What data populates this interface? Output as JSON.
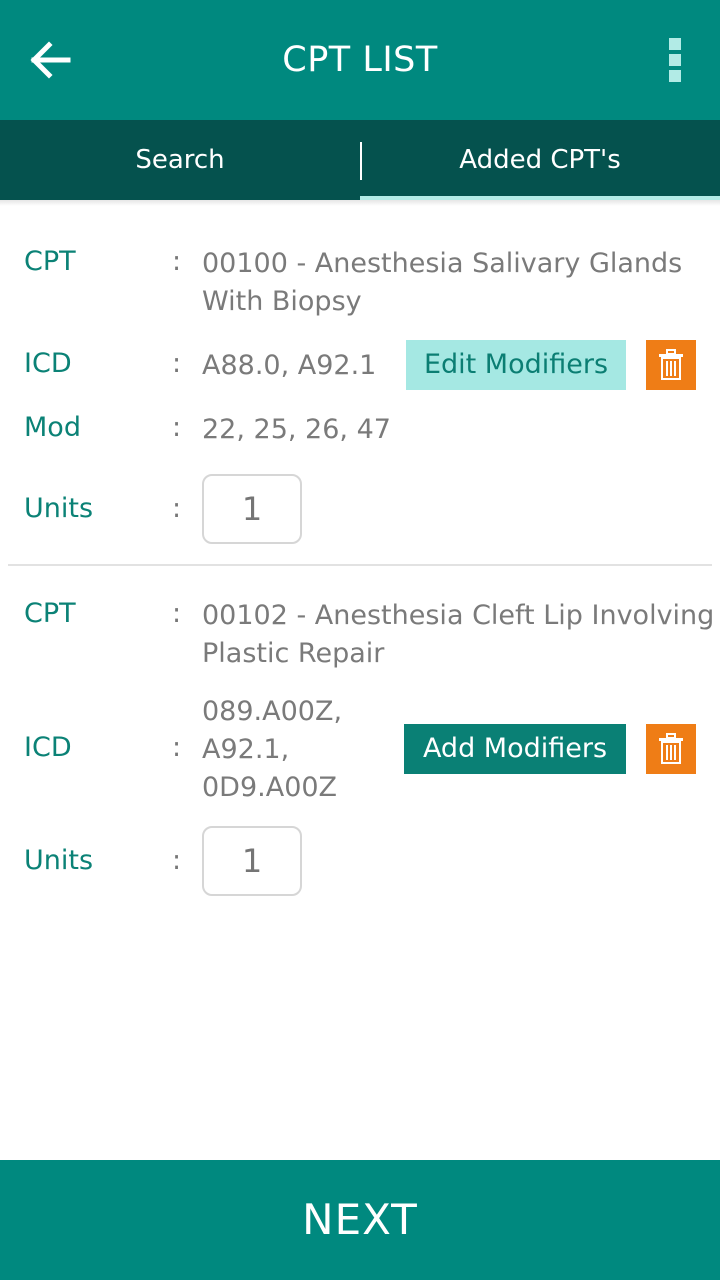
{
  "header": {
    "title": "CPT LIST",
    "back_icon": "arrow-left-icon",
    "menu_icon": "overflow-menu-icon"
  },
  "tabs": [
    {
      "label": "Search",
      "active": false
    },
    {
      "label": "Added CPT's",
      "active": true
    }
  ],
  "labels": {
    "cpt": "CPT",
    "icd": "ICD",
    "mod": "Mod",
    "units": "Units",
    "colon": ":"
  },
  "items": [
    {
      "cpt_line1": "00100 - Anesthesia Salivary Glands",
      "cpt_line2": "With Biopsy",
      "icd": "A88.0, A92.1",
      "mod": "22, 25, 26, 47",
      "units": "1",
      "modifier_button": "Edit Modifiers",
      "delete_icon": "trash-icon"
    },
    {
      "cpt_line1": "00102 - Anesthesia Cleft Lip Involving",
      "cpt_line2": "Plastic Repair",
      "icd_line1": "089.A00Z,",
      "icd_line2": "A92.1,",
      "icd_line3": "0D9.A00Z",
      "units": "1",
      "modifier_button": "Add Modifiers",
      "delete_icon": "trash-icon"
    }
  ],
  "footer": {
    "next_label": "NEXT"
  },
  "colors": {
    "primary": "#00897F",
    "tab_bar": "#05524E",
    "accent_light": "#A5E8E3",
    "delete": "#EF7D16",
    "label_text": "#0B8276"
  }
}
